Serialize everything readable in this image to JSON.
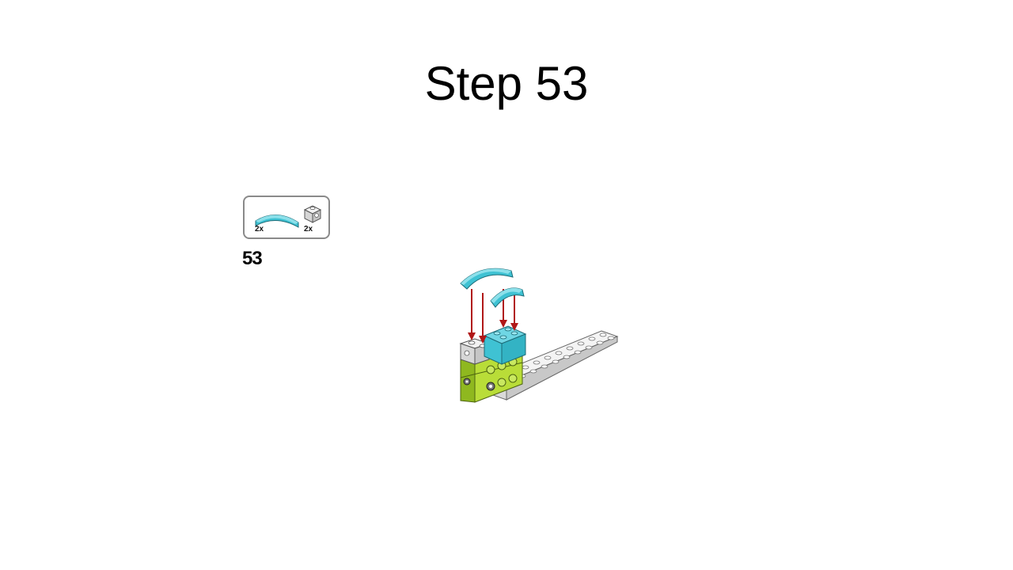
{
  "slide": {
    "title": "Step 53"
  },
  "parts_list": {
    "items": [
      {
        "part": "curved-slope-1x4",
        "quantity": "2x",
        "color": "#4bc8d8"
      },
      {
        "part": "brick-1x1-stud-side",
        "quantity": "2x",
        "color": "#d9d9d9"
      }
    ]
  },
  "step": {
    "number": "53"
  },
  "colors": {
    "medium_azure": "#3fc2d3",
    "lime": "#a6ce2a",
    "light_gray": "#dcdcdc",
    "arrow_red": "#b01818"
  }
}
